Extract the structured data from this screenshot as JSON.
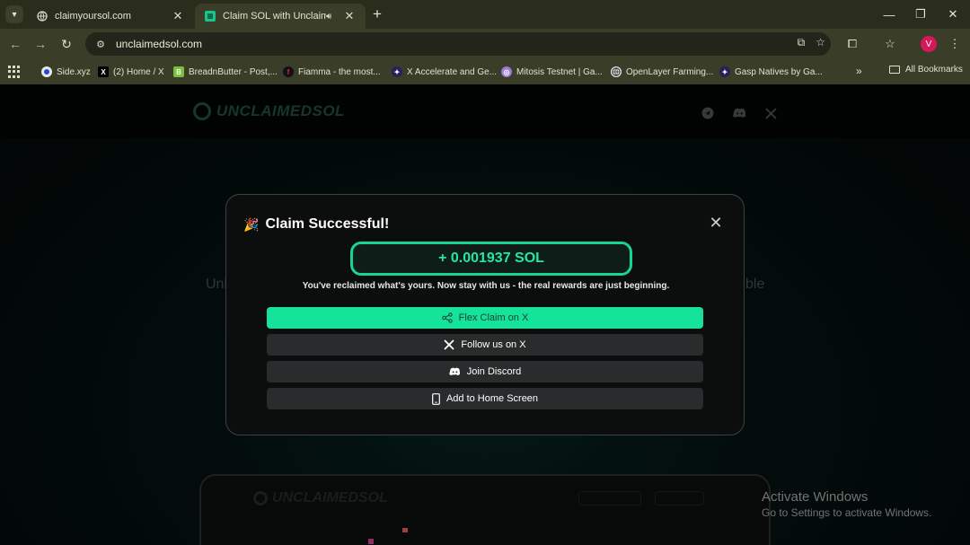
{
  "browser": {
    "tabs": [
      {
        "title": "claimyoursol.com",
        "active": false
      },
      {
        "title": "Claim SOL with Unclaimed",
        "active": true
      }
    ],
    "url": "unclaimedsol.com",
    "profile_initial": "V",
    "bookmarks": [
      {
        "label": "Side.xyz"
      },
      {
        "label": "(2) Home / X"
      },
      {
        "label": "BreadnButter - Post,..."
      },
      {
        "label": "Fiamma - the most..."
      },
      {
        "label": "X Accelerate and Ge..."
      },
      {
        "label": "Mitosis Testnet | Ga..."
      },
      {
        "label": "OpenLayer Farming..."
      },
      {
        "label": "Gasp Natives by Ga..."
      }
    ],
    "all_bookmarks_label": "All Bookmarks"
  },
  "site": {
    "logo_text": "UNCLAIMEDSOL",
    "hero_left_fragment": "Unl",
    "hero_right_fragment": "ble"
  },
  "modal": {
    "title": "Claim Successful!",
    "amount": "+ 0.001937 SOL",
    "message": "You've reclaimed what's yours. Now stay with us - the real rewards are just beginning.",
    "buttons": [
      {
        "label": "Flex Claim on X",
        "icon": "share-icon"
      },
      {
        "label": "Follow us on X",
        "icon": "x-logo-icon"
      },
      {
        "label": "Join Discord",
        "icon": "discord-icon"
      },
      {
        "label": "Add to Home Screen",
        "icon": "phone-icon"
      }
    ]
  },
  "os_watermark": {
    "line1": "Activate Windows",
    "line2": "Go to Settings to activate Windows."
  },
  "colors": {
    "accent": "#16e39a",
    "amount_text": "#22e8a0",
    "tab_strip": "#2a2d1c",
    "toolbar": "#3a3d27",
    "avatar": "#d6175a"
  }
}
